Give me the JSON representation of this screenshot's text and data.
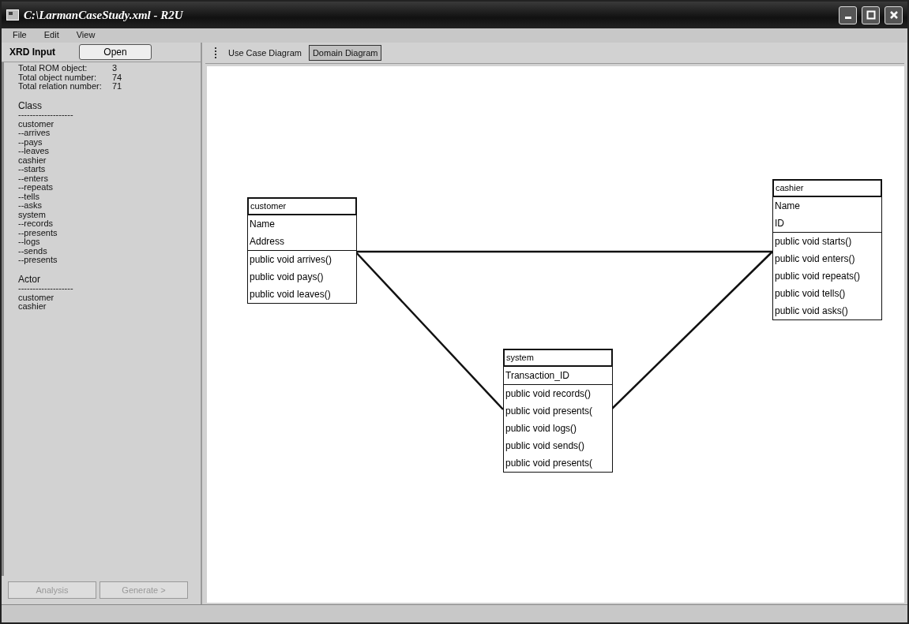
{
  "window": {
    "title": "C:\\LarmanCaseStudy.xml - R2U"
  },
  "menu": [
    "File",
    "Edit",
    "View"
  ],
  "sidebar": {
    "title": "XRD Input",
    "open_button": "Open",
    "stats": [
      {
        "label": "Total ROM object:",
        "value": "3"
      },
      {
        "label": "Total object number:",
        "value": "74"
      },
      {
        "label": "Total relation number:",
        "value": "71"
      }
    ],
    "sections": [
      {
        "heading": "Class",
        "separator": "-------------------",
        "items": [
          "customer",
          "--arrives",
          "--pays",
          "--leaves",
          "cashier",
          "--starts",
          "--enters",
          "--repeats",
          "--tells",
          "--asks",
          "system",
          "--records",
          "--presents",
          "--logs",
          "--sends",
          "--presents"
        ]
      },
      {
        "heading": "Actor",
        "separator": "-------------------",
        "items": [
          "customer",
          "cashier"
        ]
      }
    ],
    "buttons": [
      {
        "label": "Analysis",
        "disabled": true
      },
      {
        "label": "Generate >",
        "disabled": true
      }
    ]
  },
  "tabs": [
    {
      "label": "Use Case Diagram",
      "selected": false
    },
    {
      "label": "Domain Diagram",
      "selected": true
    }
  ],
  "diagram": {
    "classes": [
      {
        "name": "customer",
        "attributes": [
          "Name",
          "Address"
        ],
        "methods": [
          "public void arrives()",
          "public void pays()",
          "public void leaves()"
        ]
      },
      {
        "name": "cashier",
        "attributes": [
          "Name",
          "ID"
        ],
        "methods": [
          "public void starts()",
          "public void enters()",
          "public void repeats()",
          "public void tells()",
          "public void asks()"
        ]
      },
      {
        "name": "system",
        "attributes": [
          "Transaction_ID"
        ],
        "methods": [
          "public void records()",
          "public void presents(",
          "public void logs()",
          "public void sends()",
          "public void presents("
        ]
      }
    ]
  }
}
